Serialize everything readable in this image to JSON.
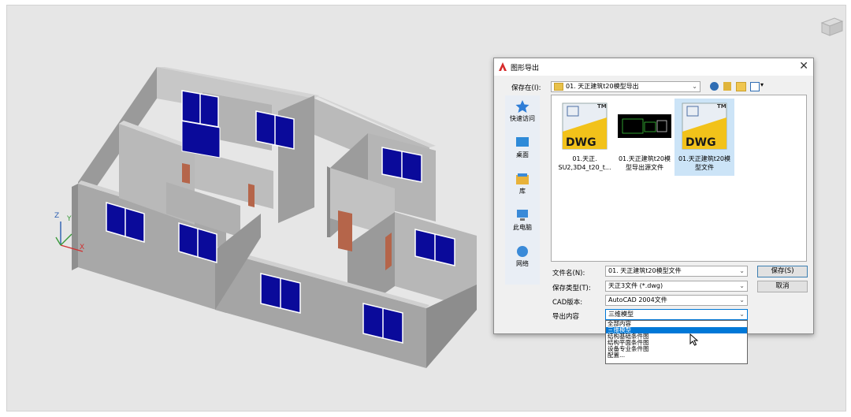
{
  "dialog": {
    "title": "图形导出",
    "close_label": "✕",
    "save_in_label": "保存在(I):",
    "save_in_value": "01. 天正建筑t20模型导出",
    "places": [
      {
        "label": "快速访问",
        "icon": "star-icon"
      },
      {
        "label": "桌面",
        "icon": "desktop-icon"
      },
      {
        "label": "库",
        "icon": "library-icon"
      },
      {
        "label": "此电脑",
        "icon": "computer-icon"
      },
      {
        "label": "网络",
        "icon": "network-icon"
      }
    ],
    "files": [
      {
        "name_line1": "01.天正.",
        "name_line2": "SU2,3D4_t20_t...",
        "icon": "dwg-file-icon",
        "badge": "DWG",
        "tm": "TM"
      },
      {
        "name_line1": "01.天正建筑t20模",
        "name_line2": "型导出源文件",
        "icon": "dwg-thumbnail-icon"
      },
      {
        "name_line1": "01.天正建筑t20模",
        "name_line2": "型文件",
        "icon": "dwg-file-icon",
        "badge": "DWG",
        "tm": "TM"
      }
    ],
    "filename_label": "文件名(N):",
    "filename_value": "01. 天正建筑t20模型文件",
    "filetype_label": "保存类型(T):",
    "filetype_value": "天正3文件 (*.dwg)",
    "cad_version_label": "CAD版本:",
    "cad_version_value": "AutoCAD 2004文件",
    "export_content_label": "导出内容",
    "export_content_value": "三维模型",
    "save_button": "保存(S)",
    "cancel_button": "取消",
    "export_options": [
      "全部内容",
      "三维模型",
      "结构基础条件图",
      "结构平面条件图",
      "设备专业条件图",
      "配置..."
    ],
    "highlighted_option": "三维模型"
  },
  "ucs": {
    "x": "X",
    "y": "Y",
    "z": "Z"
  },
  "colors": {
    "wall": "#a6a6a6",
    "wall_top": "#c4c4c4",
    "window": "#0a0a9a",
    "door": "#b5654a",
    "accent": "#0078d7"
  }
}
